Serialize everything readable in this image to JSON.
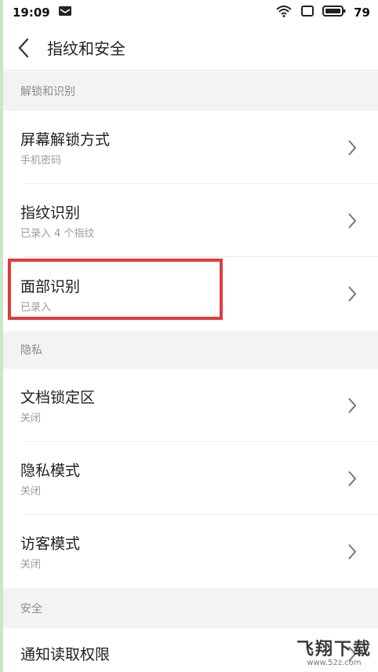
{
  "status_bar": {
    "time": "19:09",
    "battery": "79"
  },
  "header": {
    "title": "指纹和安全"
  },
  "sections": [
    {
      "title": "解锁和识别"
    },
    {
      "title": "隐私"
    },
    {
      "title": "安全"
    }
  ],
  "rows": [
    {
      "primary": "屏幕解锁方式",
      "secondary": "手机密码"
    },
    {
      "primary": "指纹识别",
      "secondary": "已录入 4 个指纹"
    },
    {
      "primary": "面部识别",
      "secondary": "已录入"
    },
    {
      "primary": "文档锁定区",
      "secondary": "关闭"
    },
    {
      "primary": "隐私模式",
      "secondary": "关闭"
    },
    {
      "primary": "访客模式",
      "secondary": "关闭"
    },
    {
      "primary": "通知读取权限",
      "secondary": ""
    }
  ],
  "watermark": {
    "main": "飞翔下载",
    "sub": "www.52z.com"
  },
  "colors": {
    "highlight": "#e23b3b",
    "section_bg": "#f3f3f3",
    "left_edge": "#c9e6c9"
  }
}
